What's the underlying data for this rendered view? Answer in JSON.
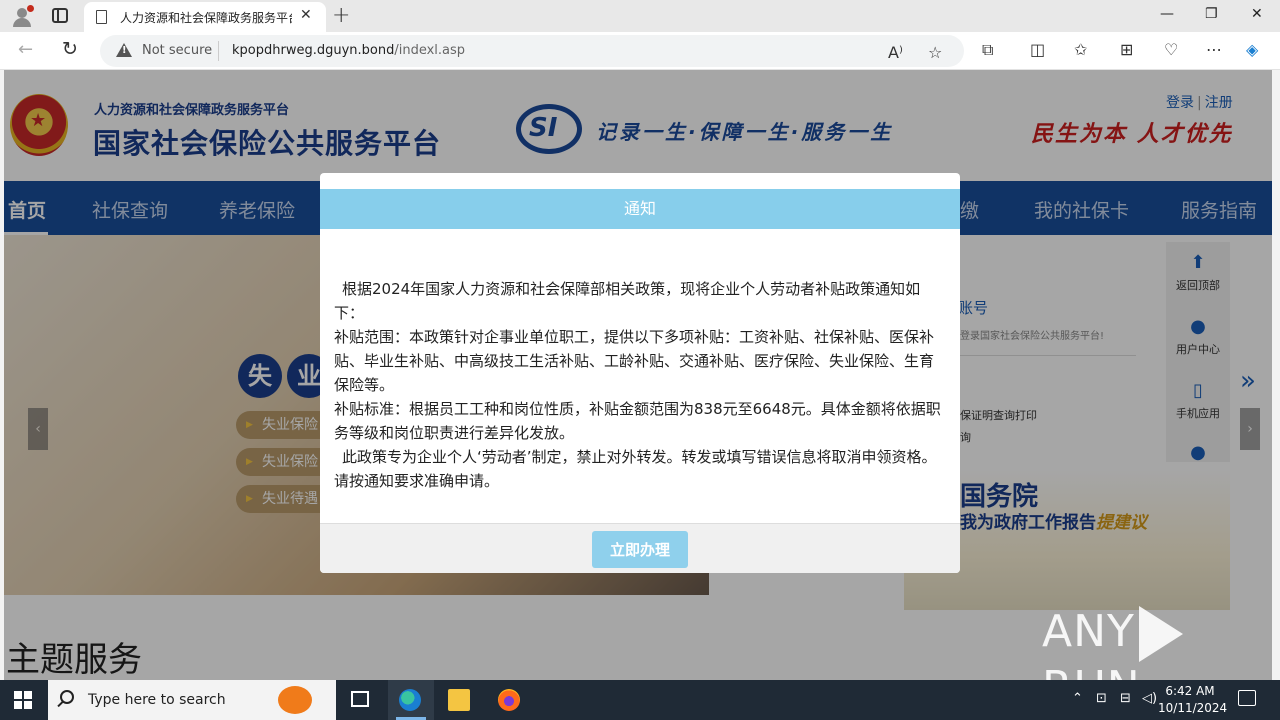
{
  "browser": {
    "tab_title": "人力资源和社会保障政务服务平台",
    "security_label": "Not secure",
    "url_host": "kpopdhrweg.dguyn.bond",
    "url_path": "/indexl.asp"
  },
  "site": {
    "org_subtitle": "人力资源和社会保障政务服务平台",
    "org_title": "国家社会保险公共服务平台",
    "logo_text": "SI",
    "slogan": "记录一生·保障一生·服务一生",
    "motto": "民生为本 人才优先",
    "login": "登录",
    "register": "注册",
    "nav": [
      "首页",
      "社保查询",
      "养老保险",
      "缴",
      "我的社保卡",
      "服务指南"
    ],
    "banner": {
      "circles": [
        "失",
        "业"
      ],
      "pills": [
        "失业保险",
        "失业保险",
        "失业待遇"
      ]
    },
    "right_panel": {
      "title": "账号",
      "welcome": "登录国家社会保险公共服务平台!",
      "items": [
        "保证明查询打印",
        "询"
      ]
    },
    "sidebar": [
      "返回顶部",
      "用户中心",
      "手机应用"
    ],
    "gov_banner": {
      "title": "国务院",
      "sub_prefix": "我为政府工作报告",
      "sub_highlight": "提建议"
    },
    "section_title": "主题服务"
  },
  "modal": {
    "title": "通知",
    "paragraphs": [
      "根据2024年国家人力资源和社会保障部相关政策，现将企业个人劳动者补贴政策通知如下：",
      "补贴范围：本政策针对企事业单位职工，提供以下多项补贴：工资补贴、社保补贴、医保补贴、毕业生补贴、中高级技工生活补贴、工龄补贴、交通补贴、医疗保险、失业保险、生育保险等。",
      "补贴标准：根据员工工种和岗位性质，补贴金额范围为838元至6648元。具体金额将依据职务等级和岗位职责进行差异化发放。",
      "此政策专为企业个人‘劳动者’制定，禁止对外转发。转发或填写错误信息将取消申领资格。请按通知要求准确申请。"
    ],
    "button": "立即办理"
  },
  "watermark": {
    "left": "ANY",
    "right": "RUN"
  },
  "taskbar": {
    "search_placeholder": "Type here to search",
    "time": "6:42 AM",
    "date": "10/11/2024"
  }
}
